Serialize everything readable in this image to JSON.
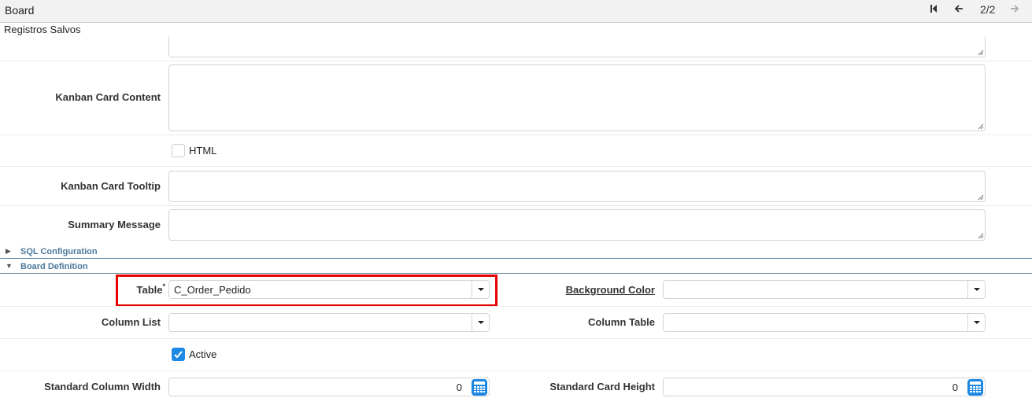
{
  "header": {
    "title": "Board",
    "nav": {
      "first_icon": "first-record-icon",
      "prev_icon": "arrow-left-icon",
      "record_counter": "2/2",
      "next_icon": "arrow-right-icon"
    }
  },
  "status_text": "Registros Salvos",
  "fields": {
    "kanban_card_content": {
      "label": "Kanban Card Content",
      "value": ""
    },
    "html": {
      "label": "HTML",
      "checked": false
    },
    "kanban_card_tooltip": {
      "label": "Kanban Card Tooltip",
      "value": ""
    },
    "summary_message": {
      "label": "Summary Message",
      "value": ""
    }
  },
  "sections": {
    "sql_configuration": {
      "label": "SQL Configuration",
      "expanded": false
    },
    "board_definition": {
      "label": "Board Definition",
      "expanded": true
    }
  },
  "board_definition": {
    "table": {
      "label": "Table",
      "required_mark": "*",
      "value": "C_Order_Pedido"
    },
    "background_color": {
      "label": "Background Color",
      "value": ""
    },
    "column_list": {
      "label": "Column List",
      "value": ""
    },
    "column_table": {
      "label": "Column Table",
      "value": ""
    },
    "active": {
      "label": "Active",
      "checked": true
    },
    "standard_column_width": {
      "label": "Standard Column Width",
      "value": "0"
    },
    "standard_card_height": {
      "label": "Standard Card Height",
      "value": "0"
    }
  },
  "colors": {
    "highlight": "#e60000",
    "section_text": "#4d7a9c",
    "checkbox_checked": "#1e88e5"
  }
}
